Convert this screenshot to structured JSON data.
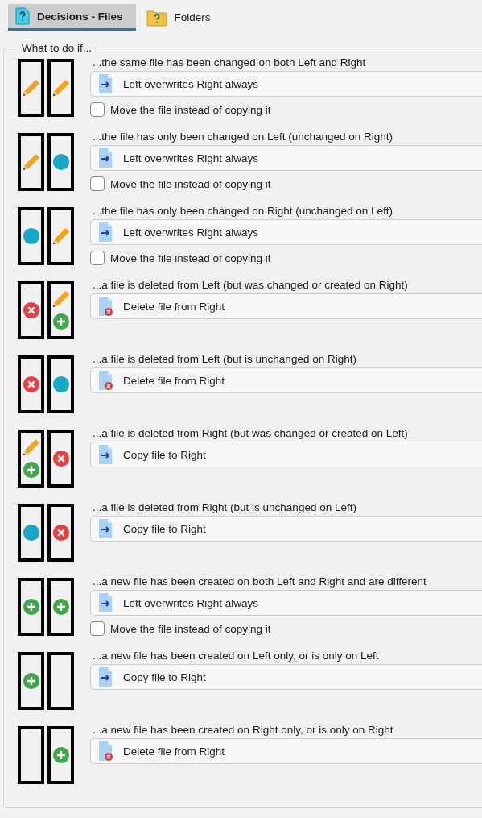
{
  "tabs": [
    {
      "label": "Decisions - Files",
      "kind": "file",
      "selected": true
    },
    {
      "label": "Folders",
      "kind": "folder",
      "selected": false
    }
  ],
  "group": {
    "title": "What to do if...",
    "rules": [
      {
        "left": {
          "kind": "changed"
        },
        "right": {
          "kind": "changed"
        },
        "question": "...the same file has been changed on both Left and Right",
        "action": {
          "kind": "copy",
          "label": "Left overwrites Right always"
        },
        "move": {
          "label": "Move the file instead of copying it",
          "checked": false
        }
      },
      {
        "left": {
          "kind": "changed"
        },
        "right": {
          "kind": "unchanged"
        },
        "question": "...the file has only been changed on Left (unchanged on Right)",
        "action": {
          "kind": "copy",
          "label": "Left overwrites Right always"
        },
        "move": {
          "label": "Move the file instead of copying it",
          "checked": false
        }
      },
      {
        "left": {
          "kind": "unchanged"
        },
        "right": {
          "kind": "changed"
        },
        "question": "...the file has only been changed on Right (unchanged on Left)",
        "action": {
          "kind": "copy",
          "label": "Left overwrites Right always"
        },
        "move": {
          "label": "Move the file instead of copying it",
          "checked": false
        }
      },
      {
        "left": {
          "kind": "deleted"
        },
        "right": {
          "kind": "changed_or_created"
        },
        "question": "...a file is deleted from Left (but was changed or created on Right)",
        "action": {
          "kind": "delete",
          "label": "Delete file from Right"
        }
      },
      {
        "left": {
          "kind": "deleted"
        },
        "right": {
          "kind": "unchanged"
        },
        "question": "...a file is deleted from Left (but is unchanged on Right)",
        "action": {
          "kind": "delete",
          "label": "Delete file from Right"
        }
      },
      {
        "left": {
          "kind": "changed_or_created"
        },
        "right": {
          "kind": "deleted"
        },
        "question": "...a file is deleted from Right (but was changed or created on Left)",
        "action": {
          "kind": "copy",
          "label": "Copy file to Right"
        }
      },
      {
        "left": {
          "kind": "unchanged"
        },
        "right": {
          "kind": "deleted"
        },
        "question": "...a file is deleted from Right (but is unchanged on Left)",
        "action": {
          "kind": "copy",
          "label": "Copy file to Right"
        }
      },
      {
        "left": {
          "kind": "created"
        },
        "right": {
          "kind": "created"
        },
        "question": "...a new file has been created on both Left and Right and are different",
        "action": {
          "kind": "copy",
          "label": "Left overwrites Right always"
        },
        "move": {
          "label": "Move the file instead of copying it",
          "checked": false
        }
      },
      {
        "left": {
          "kind": "created"
        },
        "right": {
          "kind": "none"
        },
        "question": "...a new file has been created on Left only, or is only on Left",
        "action": {
          "kind": "copy",
          "label": "Copy file to Right"
        }
      },
      {
        "left": {
          "kind": "none"
        },
        "right": {
          "kind": "created"
        },
        "question": "...a new file has been created on Right only, or is only on Right",
        "action": {
          "kind": "delete",
          "label": "Delete file from Right"
        }
      }
    ]
  }
}
